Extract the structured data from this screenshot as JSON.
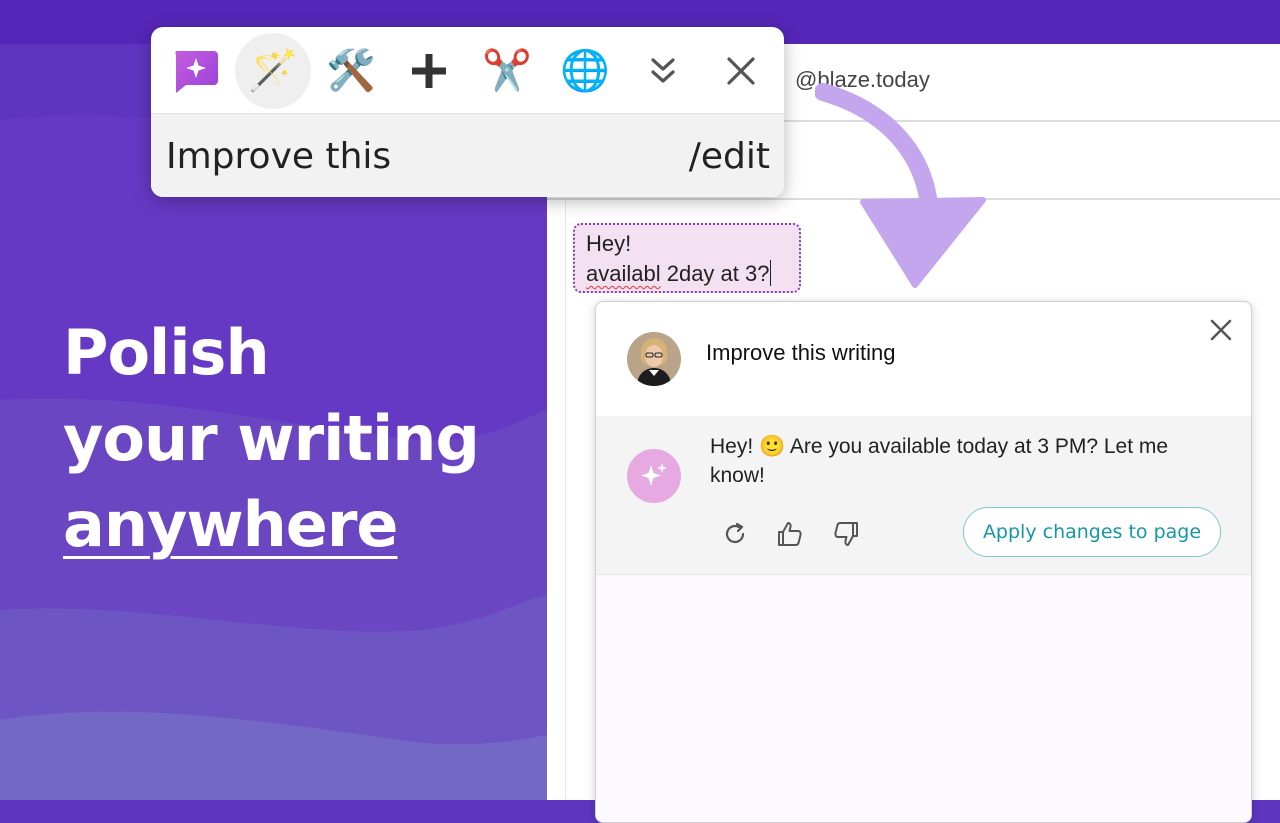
{
  "headline": {
    "line1": "Polish",
    "line2": "your writing",
    "line3": "anywhere"
  },
  "window": {
    "email_fragment": "@blaze.today"
  },
  "draft": {
    "line1": "Hey!",
    "misspelled": "availabl",
    "rest": " 2day at 3?"
  },
  "toolbar": {
    "icons": [
      "ai-chat-icon",
      "magic-wand-icon",
      "tools-icon",
      "plus-icon",
      "scissors-icon",
      "globe-icon",
      "chevron-double-down-icon",
      "close-icon"
    ],
    "label": "Improve this",
    "command": "/edit"
  },
  "panel": {
    "title": "Improve this writing",
    "response": "Hey! 🙂 Are you available today at 3 PM? Let me know!",
    "apply_label": "Apply changes to page"
  },
  "colors": {
    "background": "#5f35c0",
    "accent_teal": "#1597a6",
    "arrow": "#c3a6ee",
    "draft_highlight": "#f3e1f1"
  }
}
